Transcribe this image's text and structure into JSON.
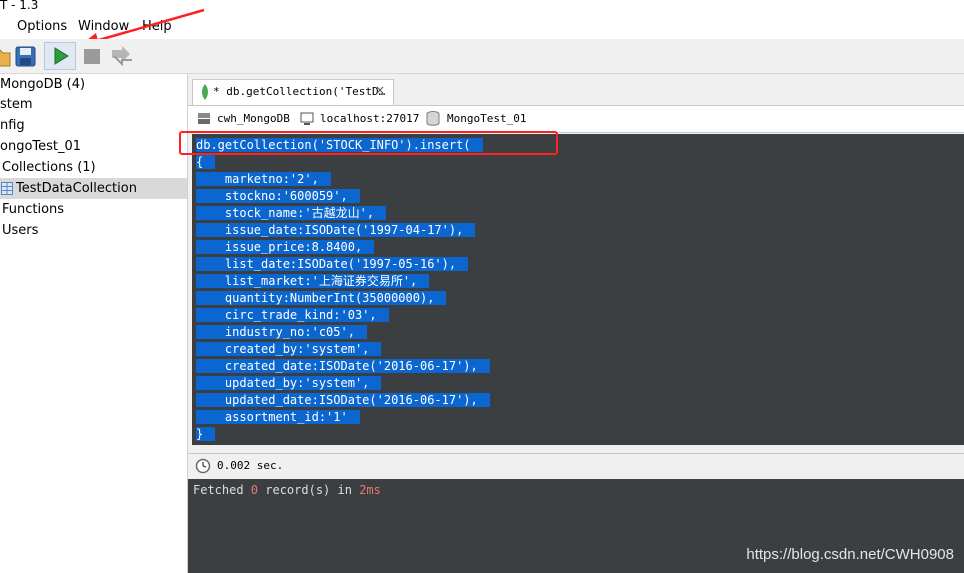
{
  "window": {
    "title": "T - 1.3"
  },
  "menu": {
    "options": "Options",
    "window": "Window",
    "help": "Help"
  },
  "toolbar": {
    "icons": [
      "open-folder-icon",
      "save-icon",
      "run-icon",
      "stop-icon",
      "format-icon"
    ]
  },
  "sidebar": {
    "items": [
      {
        "label": "MongoDB (4)"
      },
      {
        "label": "stem"
      },
      {
        "label": "nfig"
      },
      {
        "label": "ongoTest_01"
      },
      {
        "label": "Collections (1)"
      },
      {
        "label": "TestDataCollection"
      },
      {
        "label": "Functions"
      },
      {
        "label": "Users"
      }
    ]
  },
  "tab": {
    "label": "* db.getCollection('TestD…",
    "close": "×"
  },
  "connection": {
    "user": "cwh_MongoDB",
    "host": "localhost:27017",
    "database": "MongoTest_01"
  },
  "editor": {
    "lines": [
      "db.getCollection('STOCK_INFO').insert(",
      "{",
      "    marketno:'2',",
      "    stockno:'600059',",
      "    stock_name:'古越龙山',",
      "    issue_date:ISODate('1997-04-17'),",
      "    issue_price:8.8400,",
      "    list_date:ISODate('1997-05-16'),",
      "    list_market:'上海证券交易所',",
      "    quantity:NumberInt(35000000),",
      "    circ_trade_kind:'03',",
      "    industry_no:'c05',",
      "    created_by:'system',",
      "    created_date:ISODate('2016-06-17'),",
      "    updated_by:'system',",
      "    updated_date:ISODate('2016-06-17'),",
      "    assortment_id:'1'",
      "}"
    ]
  },
  "status": {
    "time": "0.002 sec."
  },
  "output": {
    "prefix": "Fetched ",
    "count": "0",
    "middle": " record(s) in ",
    "duration": "2ms"
  },
  "watermark": "https://blog.csdn.net/CWH0908",
  "colors": {
    "highlight": "#0b67cf",
    "editor_bg": "#3c3f41",
    "annotation": "#ff2020"
  }
}
